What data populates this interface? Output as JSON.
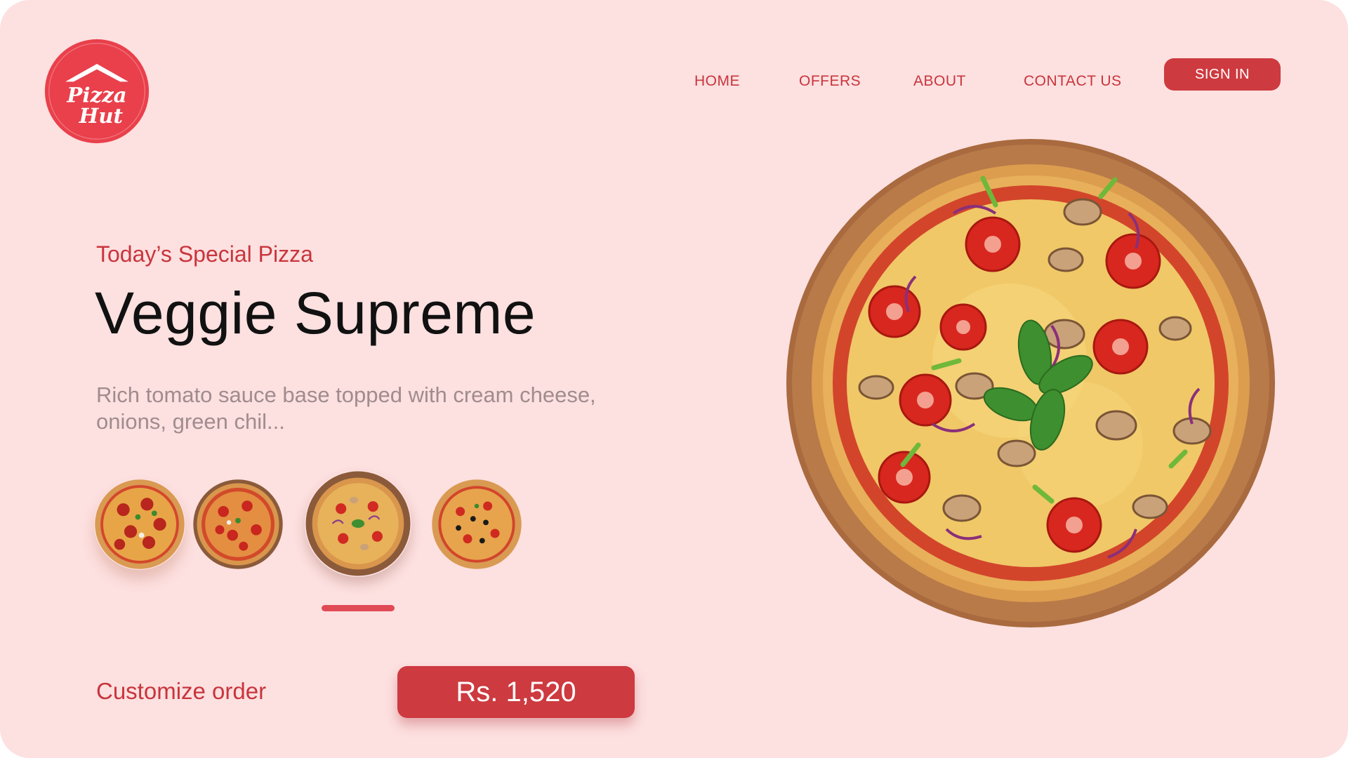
{
  "brand": {
    "logo_text_line1": "Pizza",
    "logo_text_line2": "Hut",
    "color": "#e9404b"
  },
  "nav": {
    "items": [
      {
        "label": "HOME"
      },
      {
        "label": "OFFERS"
      },
      {
        "label": "ABOUT"
      },
      {
        "label": "CONTACT US"
      }
    ],
    "signin_label": "SIGN IN"
  },
  "hero": {
    "eyebrow": "Today’s Special Pizza",
    "title": "Veggie Supreme",
    "description": "Rich tomato sauce base topped with cream cheese, onions, green chil...",
    "image_icon": "veggie-pizza-image"
  },
  "thumbnails": {
    "items": [
      {
        "icon": "pepperoni-pizza-thumbnail"
      },
      {
        "icon": "tomato-pizza-thumbnail"
      },
      {
        "icon": "veggie-supreme-thumbnail",
        "selected": true
      },
      {
        "icon": "olive-pizza-thumbnail"
      }
    ],
    "selected_index": 2
  },
  "order": {
    "customize_label": "Customize order",
    "price": "Rs. 1,520"
  },
  "colors": {
    "background": "#fde0e0",
    "accent": "#cd3a3f",
    "indicator": "#e04a55"
  }
}
